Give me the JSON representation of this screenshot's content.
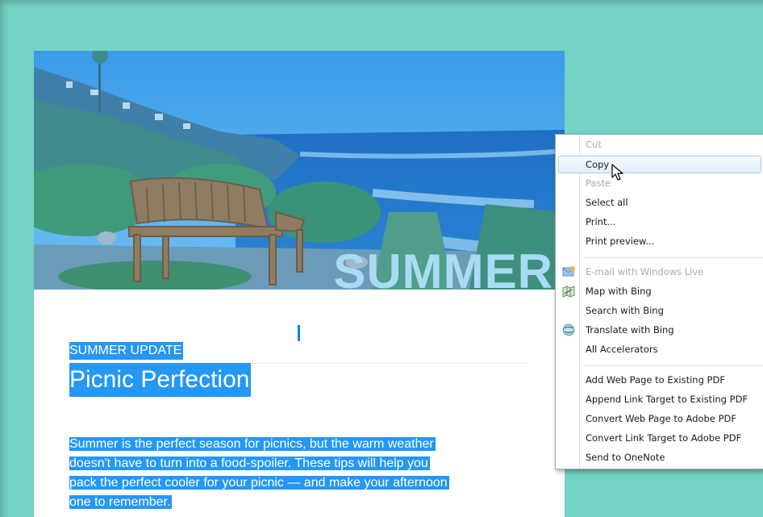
{
  "hero": {
    "title": "SUMMER"
  },
  "article": {
    "eyebrow": "SUMMER UPDATE",
    "headline": "Picnic Perfection",
    "body_lines": [
      "Summer is the perfect season for picnics, but the warm weather",
      "doesn't have to turn into a food-spoiler. These tips will help you",
      "pack the perfect cooler for your picnic — and make your afternoon",
      "one to remember."
    ]
  },
  "context_menu": {
    "items": [
      {
        "label": "Cut",
        "enabled": false
      },
      {
        "label": "Copy",
        "enabled": true,
        "hovered": true
      },
      {
        "label": "Paste",
        "enabled": false
      },
      {
        "label": "Select all",
        "enabled": true
      },
      {
        "label": "Print...",
        "enabled": true
      },
      {
        "label": "Print preview...",
        "enabled": true
      },
      {
        "label": "E-mail with Windows Live",
        "enabled": false,
        "icon": "windows-live-mail-icon"
      },
      {
        "label": "Map with Bing",
        "enabled": true,
        "icon": "map-icon"
      },
      {
        "label": "Search with Bing",
        "enabled": true
      },
      {
        "label": "Translate with Bing",
        "enabled": true,
        "icon": "translate-icon"
      },
      {
        "label": "All Accelerators",
        "enabled": true
      },
      {
        "label": "Add Web Page to Existing PDF",
        "enabled": true
      },
      {
        "label": "Append Link Target to Existing PDF",
        "enabled": true
      },
      {
        "label": "Convert Web Page to Adobe PDF",
        "enabled": true
      },
      {
        "label": "Convert Link Target to Adobe PDF",
        "enabled": true
      },
      {
        "label": "Send to OneNote",
        "enabled": true
      }
    ]
  },
  "colors": {
    "background": "#74d3c4",
    "selection": "#2597f5",
    "hero_title": "#a9dcf2"
  }
}
